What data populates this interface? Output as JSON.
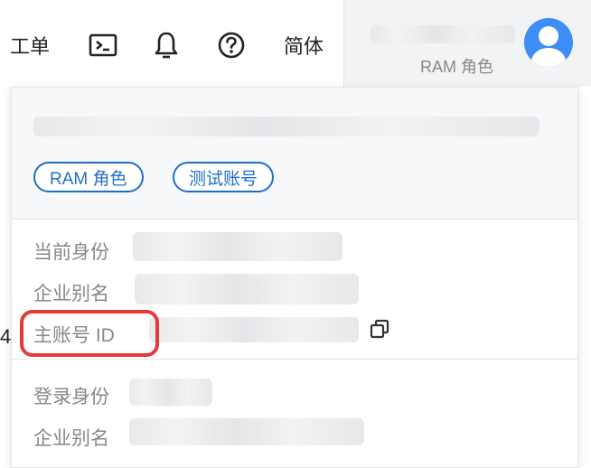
{
  "topbar": {
    "ticket_label": "工单",
    "lang_label": "简体",
    "icons": [
      "terminal-icon",
      "bell-icon",
      "help-icon"
    ]
  },
  "account": {
    "role_label": "RAM 角色",
    "avatar_color": "#3f8ef7"
  },
  "background": {
    "partial_text": "4"
  },
  "dropdown": {
    "tags": [
      "RAM 角色",
      "测试账号"
    ],
    "section1": {
      "labels": [
        "当前身份",
        "企业别名",
        "主账号 ID"
      ]
    },
    "section2": {
      "labels": [
        "登录身份",
        "企业别名"
      ]
    }
  },
  "colors": {
    "accent": "#1f6fc8",
    "highlight": "#e53935"
  }
}
